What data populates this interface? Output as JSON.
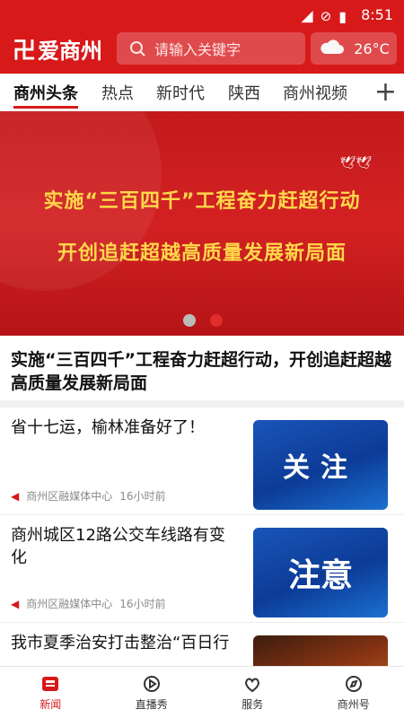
{
  "status": {
    "time": "8:51"
  },
  "header": {
    "logo_text": "爱商州",
    "search_placeholder": "请输入关键字",
    "temperature": "26°C"
  },
  "tabs": [
    {
      "label": "商州头条",
      "active": true
    },
    {
      "label": "热点"
    },
    {
      "label": "新时代"
    },
    {
      "label": "陕西"
    },
    {
      "label": "商州视频"
    }
  ],
  "banner": {
    "line1": "实施“三百四千”工程奋力赶超行动",
    "line2": "开创追赶超越高质量发展新局面",
    "active_dot": 2
  },
  "headline": "实施“三百四千”工程奋力赶超行动，开创追赶超越高质量发展新局面",
  "news": [
    {
      "title": "省十七运，榆林准备好了！",
      "source": "商州区融媒体中心",
      "time": "16小时前",
      "thumb_text": "关注"
    },
    {
      "title": "商州城区12路公交车线路有变化",
      "source": "商州区融媒体中心",
      "time": "16小时前",
      "thumb_text": "注意"
    },
    {
      "title": "我市夏季治安打击整治“百日行"
    }
  ],
  "bottom_nav": [
    {
      "label": "新闻",
      "active": true,
      "icon": "news-icon"
    },
    {
      "label": "直播秀",
      "icon": "live-icon"
    },
    {
      "label": "服务",
      "icon": "service-icon"
    },
    {
      "label": "商州号",
      "icon": "compass-icon"
    }
  ],
  "colors": {
    "brand": "#d7191a",
    "active_tab": "#d7191a"
  }
}
